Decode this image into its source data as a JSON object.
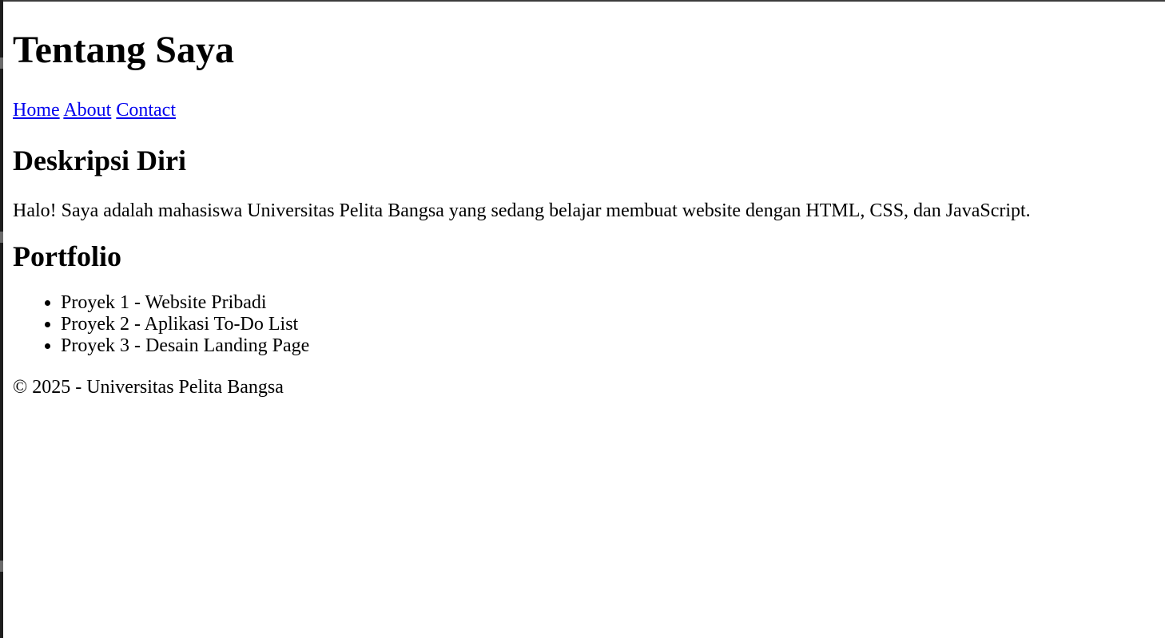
{
  "header": {
    "title": "Tentang Saya"
  },
  "nav": {
    "items": [
      {
        "label": "Home"
      },
      {
        "label": "About"
      },
      {
        "label": "Contact"
      }
    ]
  },
  "about": {
    "heading": "Deskripsi Diri",
    "text": "Halo! Saya adalah mahasiswa Universitas Pelita Bangsa yang sedang belajar membuat website dengan HTML, CSS, dan JavaScript."
  },
  "portfolio": {
    "heading": "Portfolio",
    "items": [
      {
        "label": "Proyek 1 - Website Pribadi"
      },
      {
        "label": "Proyek 2 - Aplikasi To-Do List"
      },
      {
        "label": "Proyek 3 - Desain Landing Page"
      }
    ]
  },
  "footer": {
    "text": "© 2025 - Universitas Pelita Bangsa"
  },
  "colors": {
    "link": "#0000ee",
    "text": "#000000",
    "background": "#ffffff"
  }
}
